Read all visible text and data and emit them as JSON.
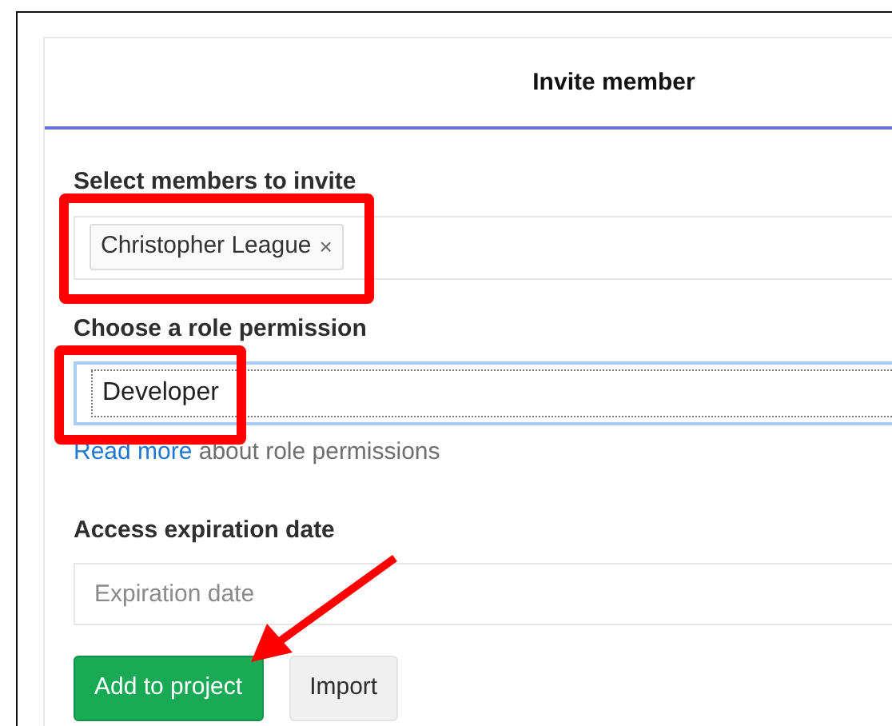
{
  "modal": {
    "title": "Invite member"
  },
  "members": {
    "label": "Select members to invite",
    "tokens": [
      {
        "name": "Christopher League",
        "remove": "×"
      }
    ]
  },
  "role": {
    "label": "Choose a role permission",
    "value": "Developer",
    "focused": true
  },
  "role_help": {
    "link": "Read more",
    "text": "about role permissions"
  },
  "expiration": {
    "label": "Access expiration date",
    "placeholder": "Expiration date"
  },
  "buttons": [
    {
      "label": "Add to project",
      "kind": "primary"
    },
    {
      "label": "Import",
      "kind": "secondary"
    }
  ]
}
